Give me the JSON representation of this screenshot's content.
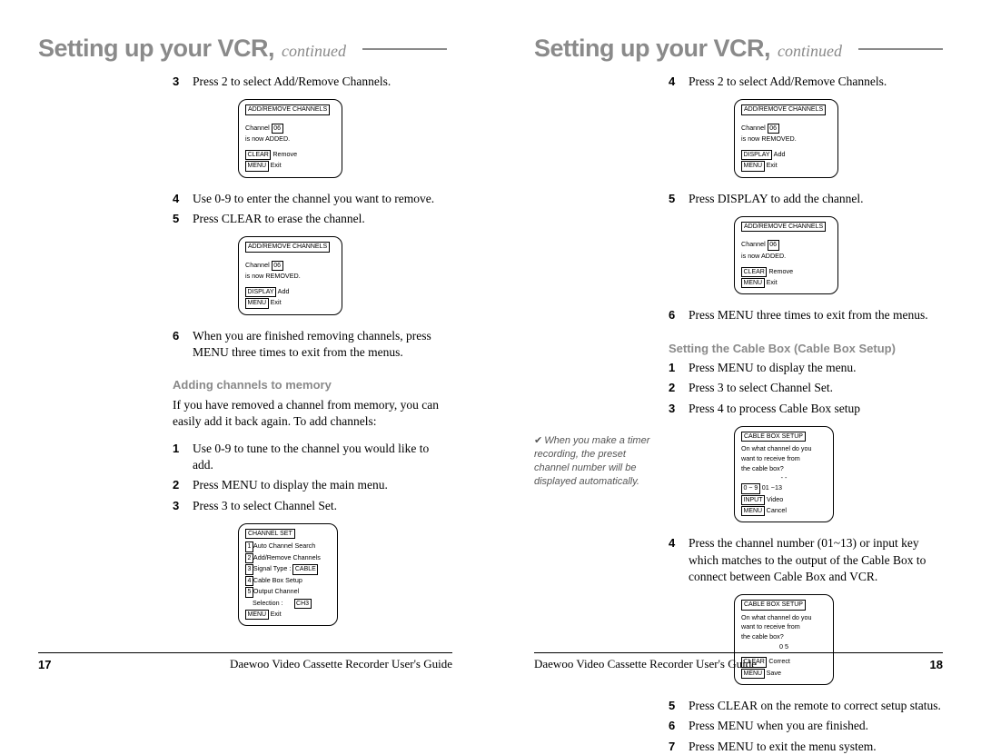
{
  "header": {
    "title": "Setting up your VCR,",
    "continued": "continued"
  },
  "left": {
    "step3": "Press 2 to select Add/Remove Channels.",
    "osd1": {
      "title": "ADD/REMOVE CHANNELS",
      "l1a": "Channel",
      "l1b": "06",
      "l2": "is now ADDED.",
      "b1": "CLEAR",
      "b1t": "Remove",
      "b2": "MENU",
      "b2t": "Exit"
    },
    "step4": "Use 0-9 to enter the channel you want to remove.",
    "step5": "Press CLEAR to erase the channel.",
    "osd2": {
      "title": "ADD/REMOVE CHANNELS",
      "l1a": "Channel",
      "l1b": "06",
      "l2": "is now REMOVED.",
      "b1": "DISPLAY",
      "b1t": "Add",
      "b2": "MENU",
      "b2t": "Exit"
    },
    "step6": "When you are finished removing channels, press MENU three times to exit from the menus.",
    "sub1": "Adding channels to memory",
    "para1": "If you have removed a channel from memory, you can easily add it back again. To add channels:",
    "a1": "Use 0-9 to tune to the channel you would like to add.",
    "a2": "Press MENU to display the main menu.",
    "a3": "Press 3 to select Channel Set.",
    "osd3": {
      "title": "CHANNEL SET",
      "m1n": "1",
      "m1": "Auto Channel Search",
      "m2n": "2",
      "m2": "Add/Remove Channels",
      "m3n": "3",
      "m3a": "Signal Type   :",
      "m3b": "CABLE",
      "m4n": "4",
      "m4": "Cable Box Setup",
      "m5n": "5",
      "m5a": "Output Channel",
      "m5b": "Selection :",
      "m5c": "CH3",
      "b": "MENU",
      "bt": "Exit"
    }
  },
  "right": {
    "step4": "Press 2 to select Add/Remove Channels.",
    "osd1": {
      "title": "ADD/REMOVE CHANNELS",
      "l1a": "Channel",
      "l1b": "06",
      "l2": "is now REMOVED.",
      "b1": "DISPLAY",
      "b1t": "Add",
      "b2": "MENU",
      "b2t": "Exit"
    },
    "step5": "Press DISPLAY to add the channel.",
    "osd2": {
      "title": "ADD/REMOVE CHANNELS",
      "l1a": "Channel",
      "l1b": "06",
      "l2": "is now ADDED.",
      "b1": "CLEAR",
      "b1t": "Remove",
      "b2": "MENU",
      "b2t": "Exit"
    },
    "step6": "Press MENU three times to exit from the menus.",
    "sub1": "Setting the Cable Box (Cable Box Setup)",
    "c1": "Press MENU to display the menu.",
    "c2": "Press 3 to select Channel Set.",
    "c3": "Press 4 to process Cable Box setup",
    "osd3": {
      "title": "CABLE BOX SETUP",
      "l1": "On what channel do you",
      "l2": "want to receive from",
      "l3": "the cable box?",
      "l4": "- -",
      "b1": "0 ~ 9",
      "b1t": "01 ~13",
      "b2": "INPUT",
      "b2t": "Video",
      "b3": "MENU",
      "b3t": "Cancel"
    },
    "c4": "Press the channel number (01~13) or input key which matches to the output of the Cable Box to connect between Cable Box and VCR.",
    "osd4": {
      "title": "CABLE BOX SETUP",
      "l1": "On what channel do you",
      "l2": "want to receive from",
      "l3": "the cable box?",
      "l4": "0 5",
      "b1": "CLEAR",
      "b1t": "Correct",
      "b2": "MENU",
      "b2t": "Save"
    },
    "c5": "Press CLEAR on the remote to correct setup status.",
    "c6": "Press MENU when you are finished.",
    "c7": "Press MENU to exit the menu system.",
    "sidenote": "When you make a timer recording, the preset channel number will be displayed automatically."
  },
  "footer": {
    "guide": "Daewoo Video Cassette Recorder User's Guide",
    "p17": "17",
    "p18": "18"
  },
  "nums": {
    "n1": "1",
    "n2": "2",
    "n3": "3",
    "n4": "4",
    "n5": "5",
    "n6": "6",
    "n7": "7"
  }
}
